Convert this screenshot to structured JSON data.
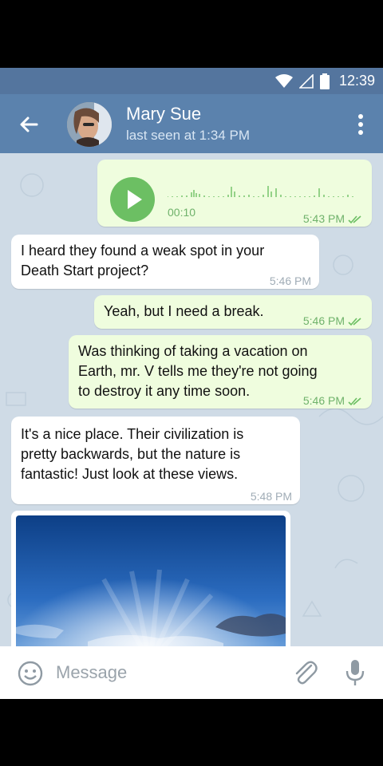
{
  "status_bar": {
    "time": "12:39",
    "icons": [
      "wifi-icon",
      "signal-icon",
      "battery-icon"
    ]
  },
  "header": {
    "contact_name": "Mary Sue",
    "last_seen": "last seen at 1:34 PM"
  },
  "messages": [
    {
      "type": "voice",
      "direction": "outgoing",
      "duration": "00:10",
      "time": "5:43 PM",
      "read": true
    },
    {
      "type": "text",
      "direction": "incoming",
      "lines": [
        "I heard they found a weak spot in your",
        "Death Start project?"
      ],
      "time": "5:46 PM"
    },
    {
      "type": "text",
      "direction": "outgoing",
      "lines": [
        "Yeah, but I need a break."
      ],
      "time": "5:46 PM",
      "read": true
    },
    {
      "type": "text",
      "direction": "outgoing",
      "lines": [
        "Was thinking of taking a vacation on",
        "Earth, mr. V tells me they're not going",
        "to destroy it any time soon."
      ],
      "time": "5:46 PM",
      "read": true
    },
    {
      "type": "text",
      "direction": "incoming",
      "lines": [
        "It's a nice place. Their civilization is",
        "pretty backwards, but the nature is",
        "fantastic! Just look at these views."
      ],
      "time": "5:48 PM"
    },
    {
      "type": "photo",
      "direction": "incoming"
    }
  ],
  "input": {
    "placeholder": "Message"
  },
  "colors": {
    "header": "#5b82ad",
    "status_bar": "#54759e",
    "outgoing_bubble": "#effdde",
    "incoming_bubble": "#ffffff",
    "accent_green": "#6cbf63"
  }
}
